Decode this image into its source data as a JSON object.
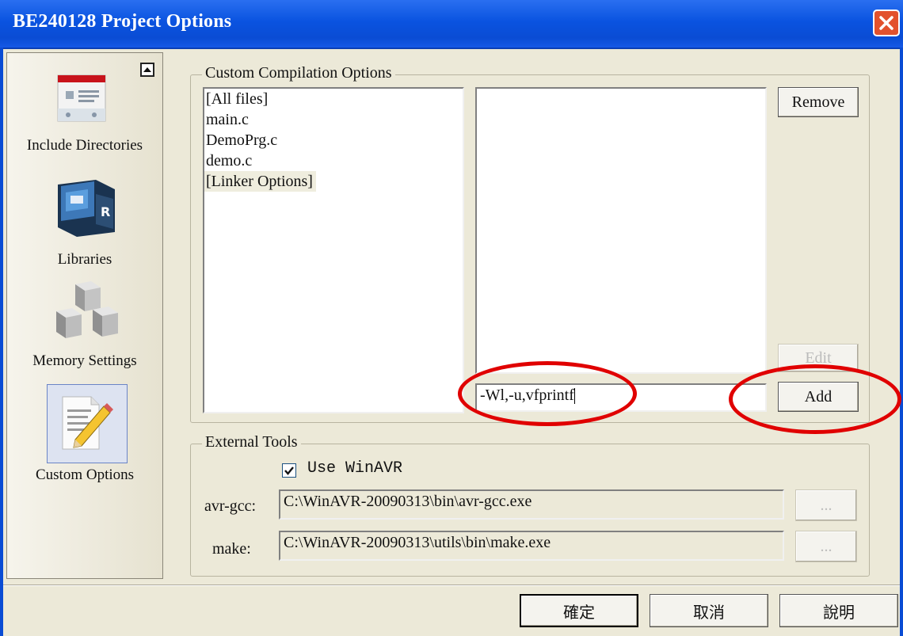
{
  "window": {
    "title": "BE240128 Project Options"
  },
  "sidebar": {
    "items": [
      {
        "label": "Include Directories",
        "icon": "include-directories-icon"
      },
      {
        "label": "Libraries",
        "icon": "libraries-book-icon"
      },
      {
        "label": "Memory Settings",
        "icon": "memory-cubes-icon"
      },
      {
        "label": "Custom Options",
        "icon": "custom-options-pencil-icon",
        "selected": true
      }
    ]
  },
  "custom_compilation": {
    "group_title": "Custom Compilation Options",
    "files": [
      "[All files]",
      "main.c",
      "DemoPrg.c",
      "demo.c",
      "[Linker Options]"
    ],
    "selected_file": "[Linker Options]",
    "options": [],
    "input_value": "-Wl,-u,vfprintf",
    "remove_label": "Remove",
    "edit_label": "Edit",
    "add_label": "Add"
  },
  "external_tools": {
    "group_title": "External Tools",
    "use_winavr_label": "Use WinAVR",
    "use_winavr_checked": true,
    "avr_gcc_label": "avr-gcc:",
    "avr_gcc_path": "C:\\WinAVR-20090313\\bin\\avr-gcc.exe",
    "make_label": "make:",
    "make_path": "C:\\WinAVR-20090313\\utils\\bin\\make.exe",
    "browse_label": "..."
  },
  "footer": {
    "ok_label": "確定",
    "cancel_label": "取消",
    "help_label": "說明"
  },
  "colors": {
    "titlebar": "#0a4cd4",
    "close": "#e2512d",
    "annotation": "#e00000"
  }
}
